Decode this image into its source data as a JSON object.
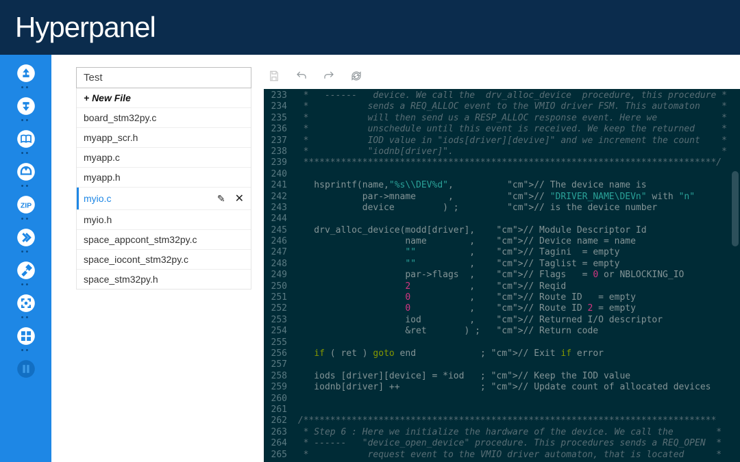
{
  "header": {
    "logo": "Hyperpanel"
  },
  "sidebar": {
    "icons": [
      "upload",
      "download",
      "book",
      "clip",
      "zip",
      "double-arrow",
      "tools",
      "focus",
      "windows",
      "pause"
    ]
  },
  "filePanel": {
    "title": "Test",
    "newFileLabel": "+ New File",
    "items": [
      {
        "name": "board_stm32py.c",
        "active": false
      },
      {
        "name": "myapp_scr.h",
        "active": false
      },
      {
        "name": "myapp.c",
        "active": false
      },
      {
        "name": "myapp.h",
        "active": false
      },
      {
        "name": "myio.c",
        "active": true
      },
      {
        "name": "myio.h",
        "active": false
      },
      {
        "name": "space_appcont_stm32py.c",
        "active": false
      },
      {
        "name": "space_iocont_stm32py.c",
        "active": false
      },
      {
        "name": "space_stm32py.h",
        "active": false
      }
    ]
  },
  "toolbar": {
    "icons": [
      "save",
      "undo",
      "redo",
      "reload"
    ]
  },
  "code": {
    "startLine": 233,
    "lines": [
      "  *   ------   device. We call the  drv_alloc_device  procedure, this procedure *",
      "  *           sends a REQ_ALLOC event to the VMIO driver FSM. This automaton    *",
      "  *           will then send us a RESP_ALLOC response event. Here we            *",
      "  *           unschedule until this event is received. We keep the returned     *",
      "  *           IOD value in \"iods[driver][devive]\" and we increment the count    *",
      "  *           \"iodnb[driver]\".                                                  *",
      "  *****************************************************************************/",
      "",
      "    hsprintf(name,\"%s\\\\DEV%d\",          // The device name is",
      "             par->mname      ,          // \"DRIVER_NAME\\DEVn\" with \"n\"",
      "             device         ) ;         // is the device number",
      "",
      "    drv_alloc_device(modd[driver],    // Module Descriptor Id",
      "                     name        ,    // Device name = name",
      "                     \"\"          ,    // Tagini  = empty",
      "                     \"\"          ,    // Taglist = empty",
      "                     par->flags  ,    // Flags   = 0 or NBLOCKING_IO",
      "                     2           ,    // Reqid",
      "                     0           ,    // Route ID   = empty",
      "                     0           ,    // Route ID 2 = empty",
      "                     iod         ,    // Returned I/O descriptor",
      "                     &ret       ) ;   // Return code",
      "",
      "    if ( ret ) goto end            ; // Exit if error",
      "",
      "    iods [driver][device] = *iod   ; // Keep the IOD value",
      "    iodnb[driver] ++               ; // Update count of allocated devices",
      "",
      "",
      " /*****************************************************************************",
      "  * Step 6 : Here we initialize the hardware of the device. We call the        *",
      "  * ------   \"device_open_device\" procedure. This procedures sends a REQ_OPEN  *",
      "  *           request event to the VMIO driver automaton, that is located      *"
    ]
  }
}
